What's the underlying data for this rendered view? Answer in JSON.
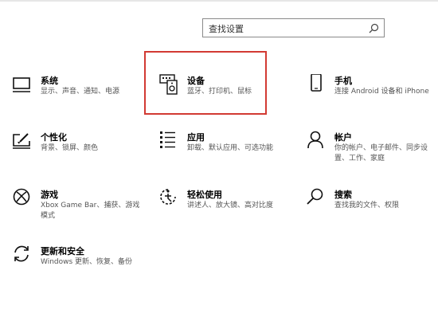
{
  "search": {
    "placeholder": "查找设置"
  },
  "tiles": [
    {
      "id": "system",
      "title": "系统",
      "subtitle": "显示、声音、通知、电源",
      "icon": "monitor-icon"
    },
    {
      "id": "devices",
      "title": "设备",
      "subtitle": "蓝牙、打印机、鼠标",
      "icon": "keyboard-speaker-icon"
    },
    {
      "id": "phone",
      "title": "手机",
      "subtitle": "连接 Android 设备和 iPhone",
      "icon": "phone-icon"
    },
    {
      "id": "personalization",
      "title": "个性化",
      "subtitle": "背景、锁屏、颜色",
      "icon": "brush-screen-icon"
    },
    {
      "id": "apps",
      "title": "应用",
      "subtitle": "卸载、默认应用、可选功能",
      "icon": "apps-list-icon"
    },
    {
      "id": "accounts",
      "title": "帐户",
      "subtitle": "你的帐户、电子邮件、同步设置、工作、家庭",
      "icon": "person-icon"
    },
    {
      "id": "gaming",
      "title": "游戏",
      "subtitle": "Xbox Game Bar、捕获、游戏模式",
      "icon": "xbox-icon"
    },
    {
      "id": "ease",
      "title": "轻松使用",
      "subtitle": "讲述人、放大镜、高对比度",
      "icon": "ease-of-access-icon"
    },
    {
      "id": "search",
      "title": "搜索",
      "subtitle": "查找我的文件、权限",
      "icon": "search-icon"
    },
    {
      "id": "update",
      "title": "更新和安全",
      "subtitle": "Windows 更新、恢复、备份",
      "icon": "sync-icon"
    }
  ],
  "colors": {
    "highlight_border": "#d23a33",
    "text": "#000000",
    "subtext": "#555555"
  }
}
